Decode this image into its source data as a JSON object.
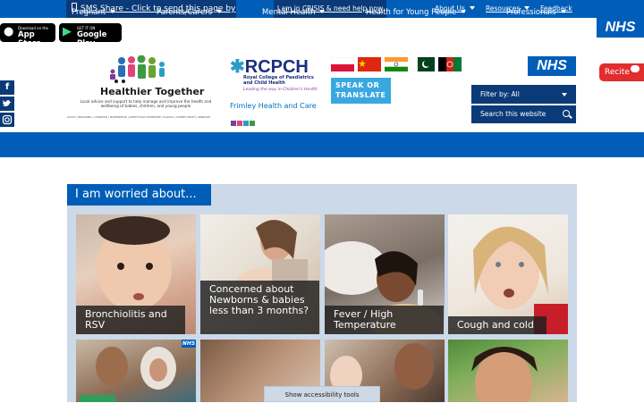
{
  "topbar": {
    "sms": "SMS Share - Click to send this page by text",
    "crisis": "I am in CRISIS & need help now",
    "links": [
      "About Us",
      "Resources",
      "Feedback"
    ]
  },
  "stores": {
    "apple_small": "Download on the",
    "apple_big": "App Store",
    "google_small": "GET IT ON",
    "google_big": "Google Play"
  },
  "social": [
    "f",
    "t",
    "ig"
  ],
  "logos": {
    "ht_title": "Healthier Together",
    "ht_sub": "Local advice and support to help manage and improve the health and wellbeing of babies, children, and young people",
    "ht_towns": "ASCOT | BRACKNELL | FARNHAM | MAIDENHEAD | NORTH EAST HAMPSHIRE | SLOUGH | SURREY HEATH | WINDSOR",
    "rcpch": "RCPCH",
    "rcpch_sub": "Royal College of Paediatrics and Child Health",
    "rcpch_tag": "Leading the way in Children's Health",
    "frimley": "Frimley Health and Care",
    "nhs": "NHS"
  },
  "translate": {
    "speak": "SPEAK OR TRANSLATE"
  },
  "recite": "Recite",
  "filter": "Filter by: All",
  "search_placeholder": "Search this website",
  "nav": [
    "Pregnant",
    "Parents/Carers",
    "Mental Health",
    "Health for Young People",
    "Professionals"
  ],
  "panel_title": "I am worried about...",
  "cards": [
    {
      "caption": "Bronchiolitis and RSV"
    },
    {
      "caption": "Concerned about Newborns & babies less than 3 months?"
    },
    {
      "caption": "Fever / High Temperature"
    },
    {
      "caption": "Cough and cold"
    }
  ],
  "accessibility": "Show accessibility tools",
  "colors": {
    "nhs_blue": "#005eb8",
    "dark_blue": "#0b3a78",
    "panel_bg": "#cbd9e9",
    "recite_red": "#e02e2e",
    "translate_blue": "#39a8e0"
  }
}
